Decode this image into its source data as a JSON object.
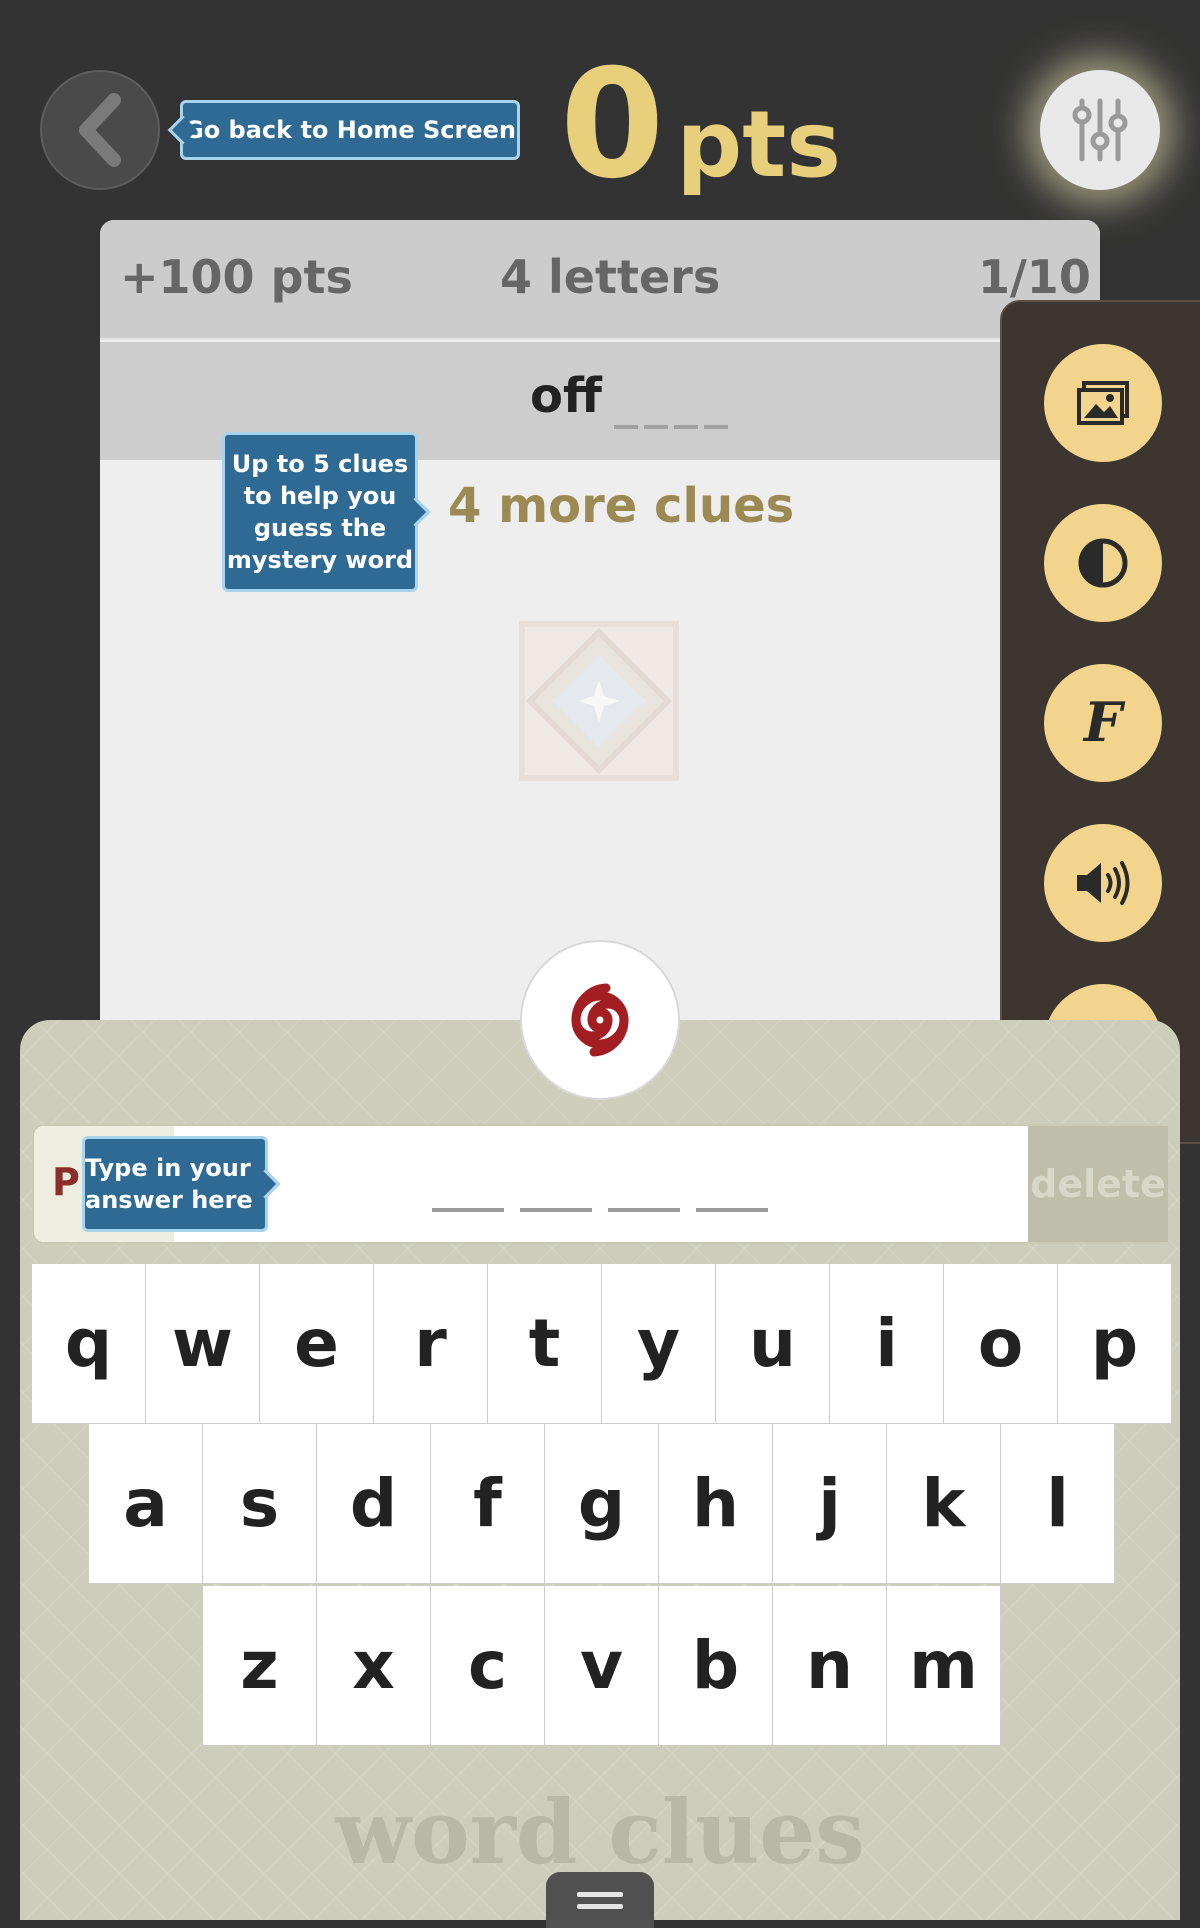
{
  "header": {
    "home_tooltip": "Go back to Home Screen",
    "score_value": "0",
    "score_unit": "pts"
  },
  "card": {
    "points": "+100 pts",
    "letters": "4 letters",
    "progress": "1/10",
    "clue_word": "off",
    "more_clues": "4 more clues",
    "clue_tooltip": "Up to 5 clues to help you guess the mystery word"
  },
  "side_panel": {
    "icons": [
      "image-icon",
      "contrast-icon",
      "font-icon",
      "sound-icon",
      "help-icon"
    ]
  },
  "answer": {
    "prefix_letter": "P",
    "tooltip": "Type in your answer here",
    "delete_label": "delete"
  },
  "keyboard": {
    "row1": [
      "q",
      "w",
      "e",
      "r",
      "t",
      "y",
      "u",
      "i",
      "o",
      "p"
    ],
    "row2": [
      "a",
      "s",
      "d",
      "f",
      "g",
      "h",
      "j",
      "k",
      "l"
    ],
    "row3": [
      "z",
      "x",
      "c",
      "v",
      "b",
      "n",
      "m"
    ]
  },
  "brand": "word clues",
  "colors": {
    "score": "#e8cf7c",
    "tooltip": "#2e6a93",
    "side_button": "#f2d48d",
    "clue_hint": "#9c8a55"
  }
}
